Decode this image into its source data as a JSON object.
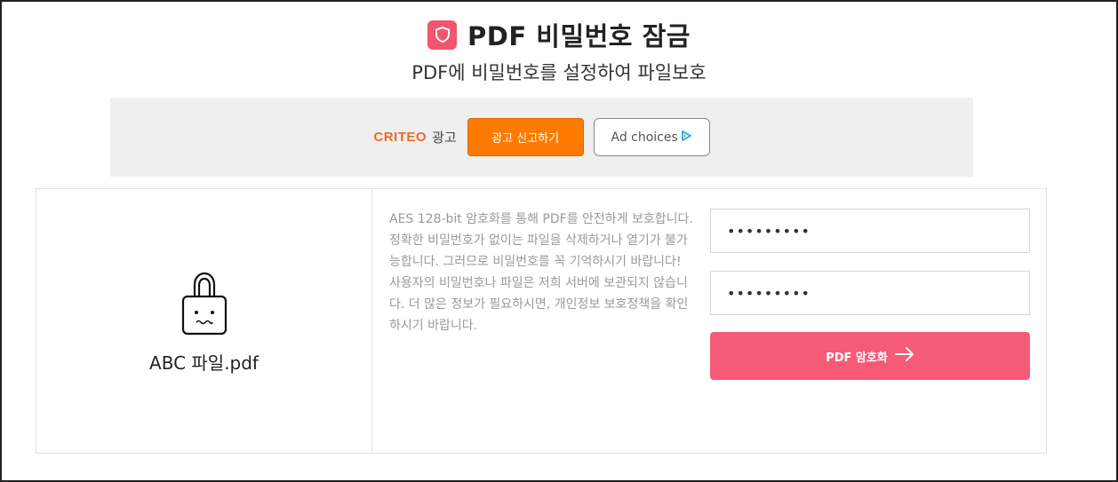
{
  "header": {
    "title": "PDF 비밀번호 잠금",
    "subtitle": "PDF에 비밀번호를 설정하여 파일보호"
  },
  "ad": {
    "brand": "CRITEO",
    "ad_label": "광고",
    "report_label": "광고 신고하기",
    "adchoices_label": "Ad choices"
  },
  "file": {
    "name": "ABC 파일.pdf",
    "icon": "lock-icon"
  },
  "description": {
    "para1": "AES 128-bit 암호화를 통해 PDF를 안전하게 보호합니다. 정확한 비밀번호가 없이는 파일을 삭제하거나 열기가 불가능합니다. 그러므로 비밀번호를 꼭 기억하시기 바랍니다!",
    "para2": "사용자의 비밀번호나 파일은 저희 서버에 보관되지 않습니다. 더 많은 정보가 필요하시면, 개인정보 보호정책을 확인하시기 바랍니다."
  },
  "form": {
    "password1_value": "•••••••••",
    "password2_value": "•••••••••",
    "submit_label": "PDF 암호화"
  },
  "colors": {
    "accent": "#f55b77",
    "title_icon": "#f0566e",
    "report_button": "#ff7b00",
    "criteo": "#f06a25"
  }
}
